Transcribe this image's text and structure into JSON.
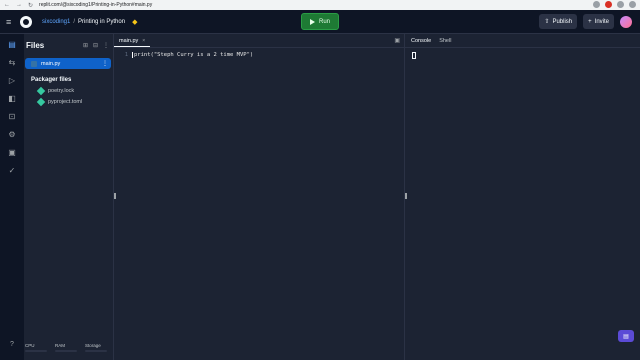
{
  "browser": {
    "url": "replit.com/@sixcoding1/Printing-in-Python#main.py"
  },
  "header": {
    "user": "sixcoding1",
    "separator": "/",
    "project": "Printing in Python",
    "run_label": "Run",
    "publish_label": "Publish",
    "invite_label": "Invite"
  },
  "files_panel": {
    "title": "Files",
    "items": [
      {
        "name": "main.py"
      }
    ],
    "packager_title": "Packager files",
    "packager_items": [
      {
        "name": "poetry.lock"
      },
      {
        "name": "pyproject.toml"
      }
    ],
    "usage": {
      "cpu": "CPU",
      "ram": "RAM",
      "storage": "Storage"
    }
  },
  "editor": {
    "tab_label": "main.py",
    "line_number": "1",
    "code_line": "print(\"Steph Curry is a 2 time MVP\")"
  },
  "console_panel": {
    "tabs": [
      {
        "label": "Console"
      },
      {
        "label": "Shell"
      }
    ]
  },
  "icons": {
    "menu": "hamburger-icon",
    "run": "play-icon",
    "chat": "chat-icon"
  },
  "colors": {
    "run_button": "#1e7a34",
    "selected_file": "#0f62c9",
    "link": "#5ea6ff"
  }
}
